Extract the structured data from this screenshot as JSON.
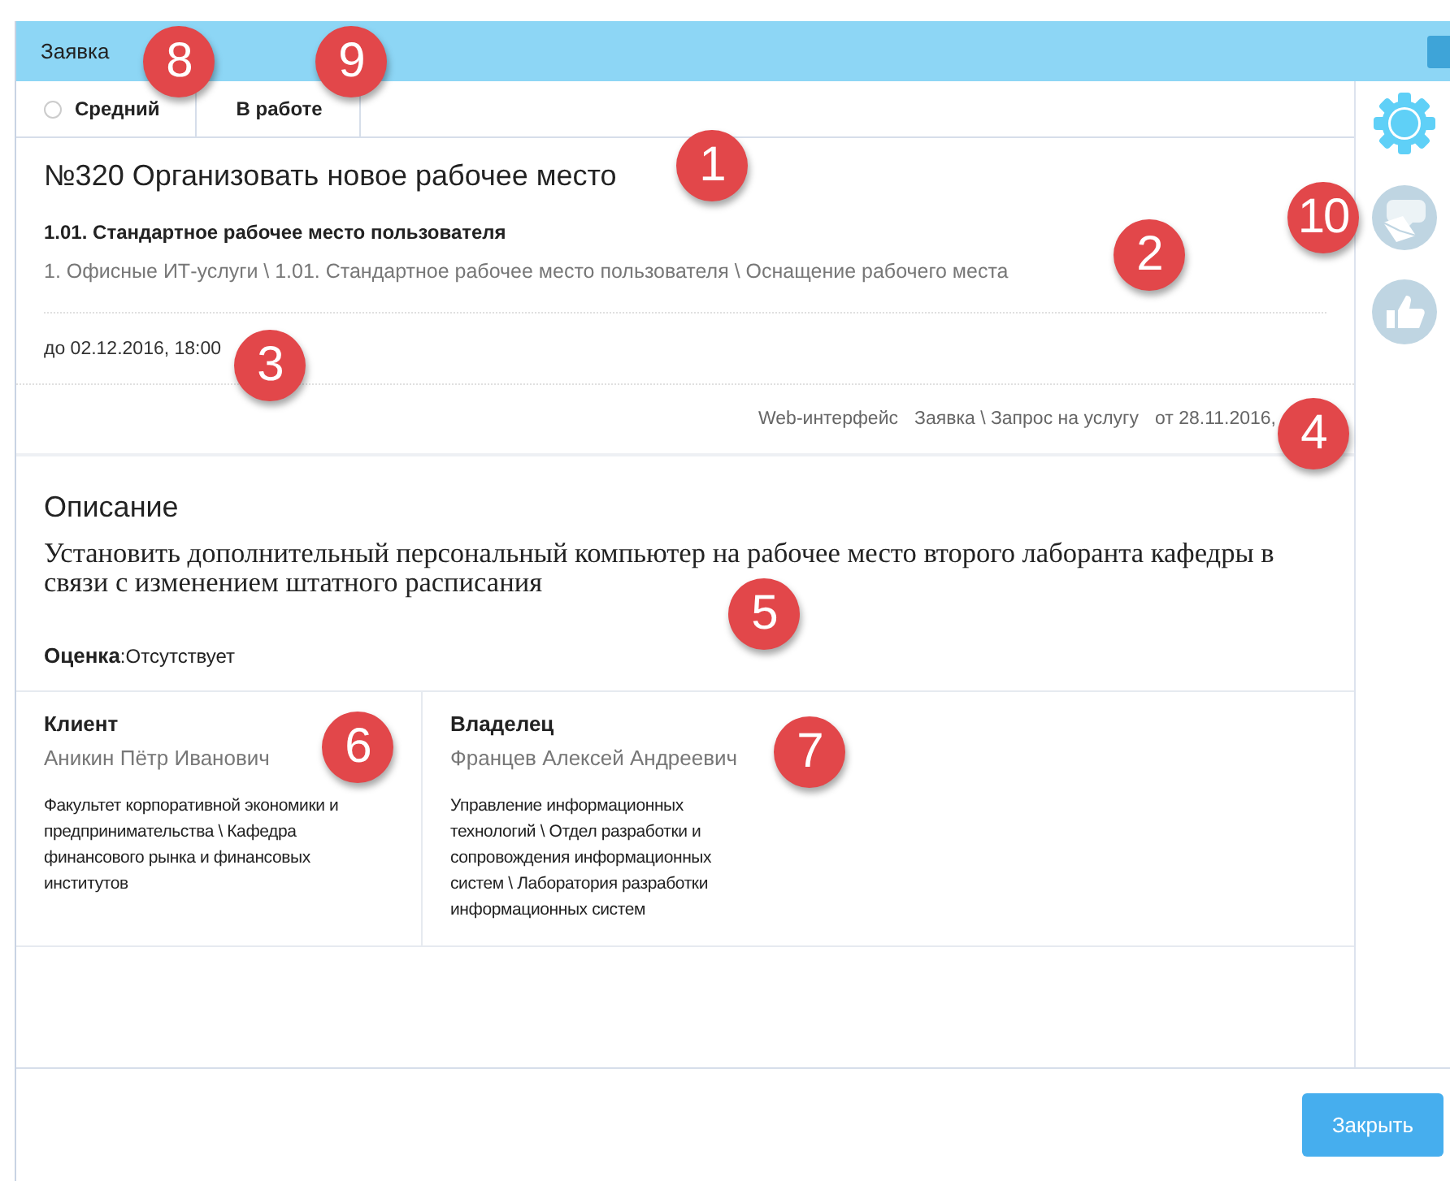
{
  "window": {
    "title": "Заявка"
  },
  "tabs": [
    {
      "kind": "radio",
      "label": "Средний",
      "checked": false
    },
    {
      "kind": "plain",
      "label": "В работе"
    }
  ],
  "request": {
    "title": "№320 Организовать новое рабочее место",
    "service": "1.01. Стандартное рабочее место пользователя",
    "path": "1. Офисные ИТ-услуги \\ 1.01. Стандартное рабочее место пользователя \\ Оснащение рабочего места",
    "deadline": "до 02.12.2016, 18:00",
    "meta": [
      "Web-интерфейс",
      "Заявка \\ Запрос на услугу",
      "от 28.11.2016,"
    ]
  },
  "description": {
    "heading": "Описание",
    "text": "Установить дополнительный персональный компьютер на рабочее место второго лаборанта кафедры в связи с изменением штатного расписания",
    "rating": "**Оценка**:Отсутствует"
  },
  "parties": [
    {
      "role": "Клиент",
      "name": "Аникин Пётр Иванович",
      "department": "Факультет корпоративной экономики и предпринимательства \\ Кафедра финансового рынка и финансовых институтов"
    },
    {
      "role": "Владелец",
      "name": "Францев Алексей Андреевич",
      "department": "Управление информационных технологий \\ Отдел разработки и сопровождения информационных систем \\ Лаборатория разработки информационных систем"
    }
  ],
  "sidebar": [
    {
      "kind": "settings",
      "active": true
    },
    {
      "kind": "messages",
      "active": false
    },
    {
      "kind": "like",
      "active": false
    }
  ],
  "footer": {
    "button": "Закрыть"
  },
  "callouts": [
    {
      "label": "8"
    },
    {
      "label": "9"
    },
    {
      "label": "1"
    },
    {
      "label": "10"
    },
    {
      "label": "2"
    },
    {
      "label": "3"
    },
    {
      "label": "4"
    },
    {
      "label": "5"
    },
    {
      "label": "6"
    },
    {
      "label": "7"
    }
  ]
}
